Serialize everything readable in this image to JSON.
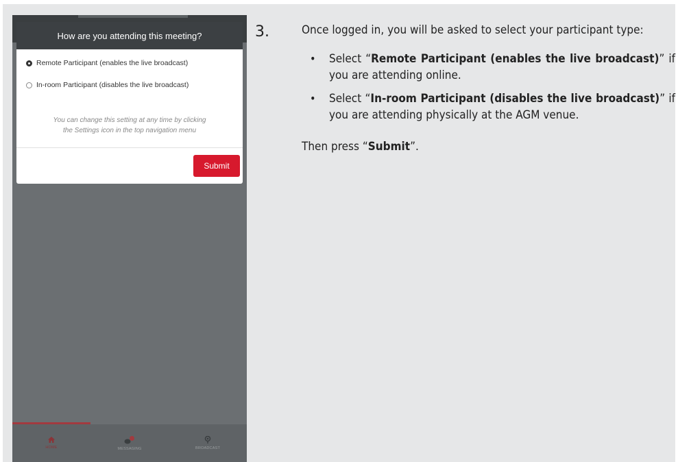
{
  "dialog": {
    "title": "How are you attending this meeting?",
    "options": [
      {
        "label": "Remote Participant (enables the live broadcast)",
        "selected": true
      },
      {
        "label": "In-room Participant (disables the live broadcast)",
        "selected": false
      }
    ],
    "hint_line1": "You can change this setting at any time by clicking",
    "hint_line2": "the Settings icon in the top navigation menu",
    "submit_label": "Submit"
  },
  "bottom_nav": {
    "items": [
      {
        "label": "HOME",
        "icon": "home-icon",
        "active": true
      },
      {
        "label": "MESSAGING",
        "icon": "chat-bubbles-icon",
        "active": false
      },
      {
        "label": "BROADCAST",
        "icon": "broadcast-icon",
        "active": false
      }
    ]
  },
  "instructions": {
    "step_number": "3.",
    "intro": "Once logged in, you will be asked to select your participant type:",
    "bullet1_pre": "Select “",
    "bullet1_bold": "Remote Participant (enables the live broadcast)",
    "bullet1_post": "” if you are attending online.",
    "bullet2_pre": "Select “",
    "bullet2_bold": "In-room Participant (disables the live broadcast)",
    "bullet2_post": "” if you are attending physically at the AGM venue.",
    "then_pre": "Then press “",
    "then_bold": "Submit",
    "then_post": "”."
  },
  "colors": {
    "submit": "#d7192d",
    "nav_active": "#a23a3f",
    "panel_bg": "#e6e7e8"
  }
}
